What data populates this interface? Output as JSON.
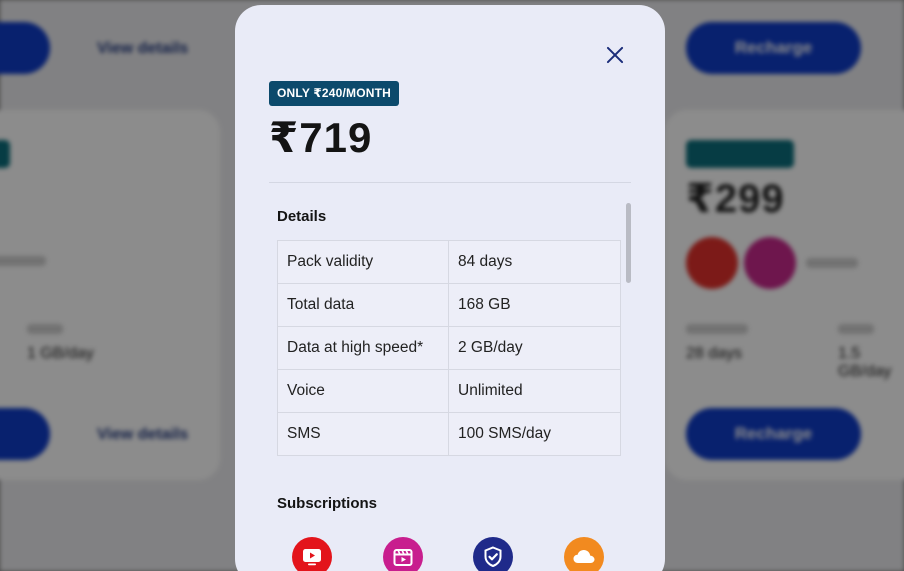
{
  "background": {
    "left_card": {
      "link_label": "View details",
      "data_value": "1 GB/day",
      "button_label": "Recharge"
    },
    "right_card": {
      "price": "₹299",
      "validity_value": "28 days",
      "data_value": "1.5 GB/day",
      "button_label": "Recharge"
    }
  },
  "modal": {
    "offer_badge": "ONLY ₹240/MONTH",
    "price": "₹719",
    "details_title": "Details",
    "details": [
      {
        "label": "Pack validity",
        "value": "84 days"
      },
      {
        "label": "Total data",
        "value": "168 GB"
      },
      {
        "label": "Data at high speed*",
        "value": "2 GB/day"
      },
      {
        "label": "Voice",
        "value": "Unlimited"
      },
      {
        "label": "SMS",
        "value": "100 SMS/day"
      }
    ],
    "subscriptions_title": "Subscriptions",
    "subscriptions": [
      {
        "icon": "tv-app-icon",
        "color": "#e3141b"
      },
      {
        "icon": "cinema-app-icon",
        "color": "#c81e8e"
      },
      {
        "icon": "security-app-icon",
        "color": "#1f2a8a"
      },
      {
        "icon": "cloud-app-icon",
        "color": "#f28a1f"
      }
    ]
  },
  "colors": {
    "accent": "#0f3cc9",
    "badge": "#0c4a6c",
    "modal_bg": "#e9ebf7"
  }
}
